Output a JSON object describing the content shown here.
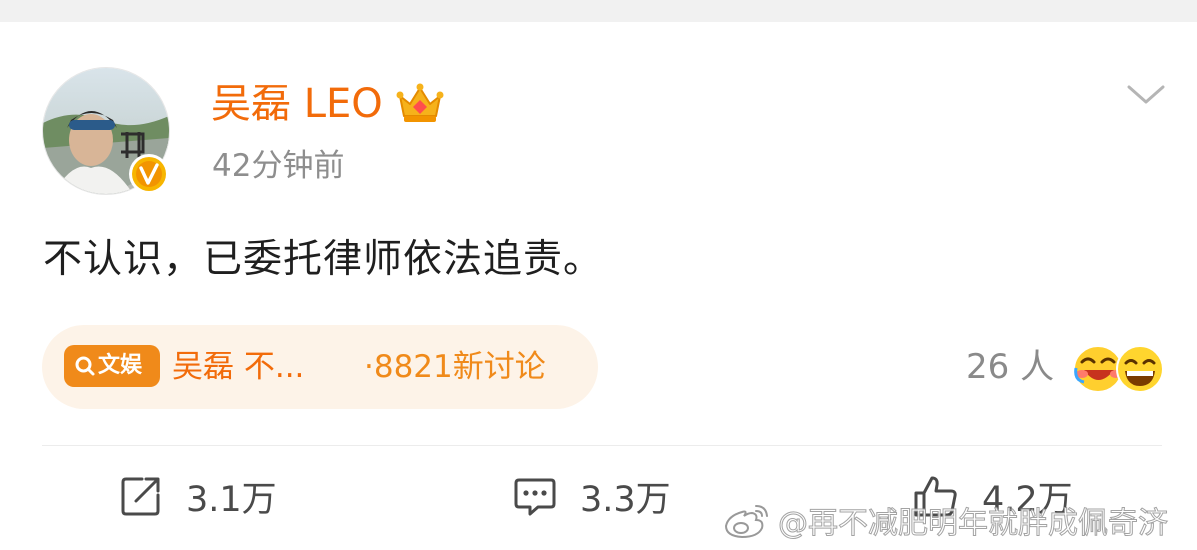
{
  "post": {
    "username": "吴磊 LEO",
    "time": "42分钟前",
    "text": "不认识，已委托律师依法追责。"
  },
  "topic": {
    "tag_label": "文娱",
    "title": "吴磊 不...",
    "count": "·8821新讨论"
  },
  "reactions": {
    "count": "26 人"
  },
  "actions": {
    "repost": "3.1万",
    "comment": "3.3万",
    "like": "4.2万"
  },
  "watermark": {
    "text": "@再不减肥明年就胖成佩奇济"
  },
  "colors": {
    "username": "#f26b0a",
    "tag_bg": "#f08a1a",
    "pill_bg": "#fdf3e8",
    "muted_text": "#8e8e8e"
  },
  "icons": [
    "verified-badge-icon",
    "crown-icon",
    "chevron-down-icon",
    "search-icon",
    "laughing-emoji-icon",
    "grinning-emoji-icon",
    "repost-icon",
    "comment-icon",
    "like-icon",
    "weibo-logo-icon"
  ]
}
